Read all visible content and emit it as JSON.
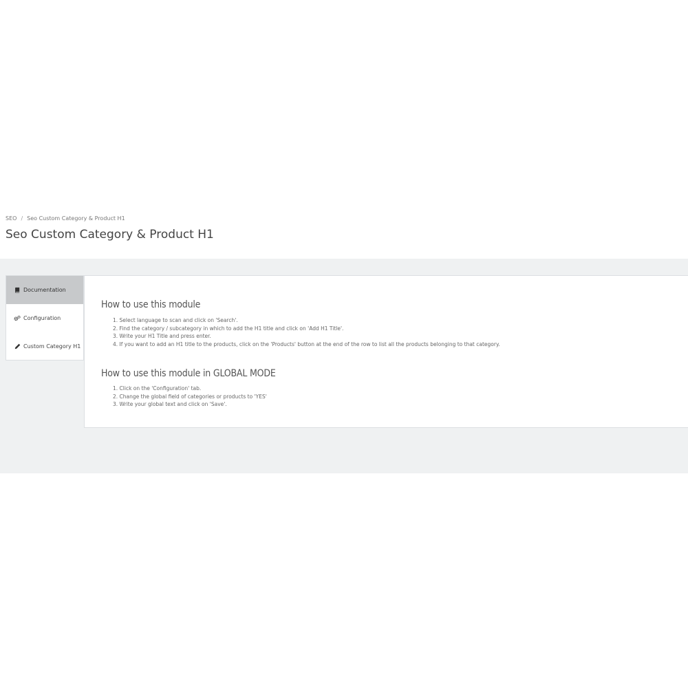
{
  "breadcrumb": {
    "root": "SEO",
    "separator": "/",
    "current": "Seo Custom Category & Product H1"
  },
  "page_title": "Seo Custom Category & Product H1",
  "tabs": [
    {
      "label": "Documentation",
      "icon": "book-icon",
      "active": true
    },
    {
      "label": "Configuration",
      "icon": "gears-icon",
      "active": false
    },
    {
      "label": "Custom Category H1",
      "icon": "pencil-icon",
      "active": false
    }
  ],
  "sections": [
    {
      "title": "How to use this module",
      "steps": [
        "1. Select language to scan and click on 'Search'.",
        "2. Find the category / subcategory in which to add the H1 title and click on 'Add H1 Title'.",
        "3. Write your H1 Title and press enter.",
        "4. If you want to add an H1 title to the products, click on the 'Products' button at the end of the row to list all the products belonging to that category."
      ]
    },
    {
      "title": "How to use this module in GLOBAL MODE",
      "steps": [
        "1. Click on the 'Configuration' tab.",
        "2. Change the global field of categories or products to 'YES'",
        "3. Write your global text and click on 'Save'."
      ]
    }
  ],
  "colors": {
    "active_tab": "#c7c9cb",
    "content_background": "#eff1f2",
    "border": "#dcdfe2"
  }
}
